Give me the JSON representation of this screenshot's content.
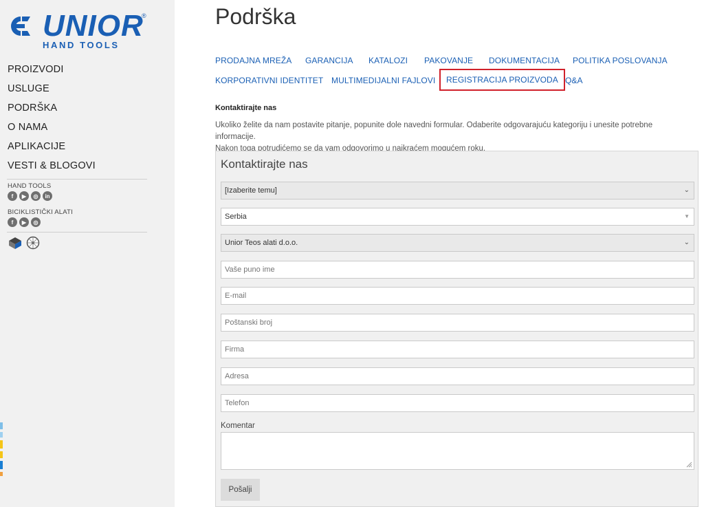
{
  "brand": {
    "name": "UNIOR",
    "tagline": "HAND TOOLS",
    "registered_mark": "®",
    "color": "#1a5fb4"
  },
  "sidebar": {
    "nav": [
      {
        "label": "PROIZVODI"
      },
      {
        "label": "USLUGE"
      },
      {
        "label": "PODRŠKA"
      },
      {
        "label": "O NAMA"
      },
      {
        "label": "APLIKACIJE"
      },
      {
        "label": "VESTI & BLOGOVI"
      }
    ],
    "social_groups": [
      {
        "label": "HAND TOOLS",
        "icons": [
          "facebook-icon",
          "youtube-icon",
          "instagram-icon",
          "linkedin-icon"
        ]
      },
      {
        "label": "BICIKLISTIČKI ALATI",
        "icons": [
          "facebook-icon",
          "youtube-icon",
          "instagram-icon"
        ]
      }
    ],
    "apps": [
      "tools-app-icon",
      "bike-wheel-app-icon"
    ]
  },
  "page": {
    "title": "Podrška"
  },
  "tabs": [
    {
      "label": "PRODAJNA MREŽA"
    },
    {
      "label": "GARANCIJA"
    },
    {
      "label": "KATALOZI"
    },
    {
      "label": "PAKOVANJE"
    },
    {
      "label": "DOKUMENTACIJA"
    },
    {
      "label": "POLITIKA POSLOVANJA"
    },
    {
      "label": "KORPORATIVNI IDENTITET"
    },
    {
      "label": "MULTIMEDIJALNI FAJLOVI"
    },
    {
      "label": "REGISTRACIJA PROIZVODA",
      "highlighted": true
    },
    {
      "label": "Q&A"
    }
  ],
  "contact": {
    "heading": "Kontaktirajte nas",
    "intro_line1": "Ukoliko želite da nam postavite pitanje, popunite dole navedni formular. Odaberite odgovarajuću kategoriju i unesite potrebne informacije.",
    "intro_line2": "Nakon toga potrudićemo se da vam odgovorimo u najkraćem mogućem roku."
  },
  "form": {
    "title": "Kontaktirajte nas",
    "topic_select": "[Izaberite temu]",
    "country_select": "Serbia",
    "company_select": "Unior Teos alati d.o.o.",
    "placeholders": {
      "full_name": "Vaše puno ime",
      "email": "E-mail",
      "postal_code": "Poštanski broj",
      "company": "Firma",
      "address": "Adresa",
      "phone": "Telefon"
    },
    "comment_label": "Komentar",
    "submit_label": "Pošalji"
  },
  "colors": {
    "link": "#1a5fb4",
    "highlight_border": "#d0202a",
    "sidebar_bg": "#f1f1f1",
    "form_bg": "#f0f0f0"
  }
}
